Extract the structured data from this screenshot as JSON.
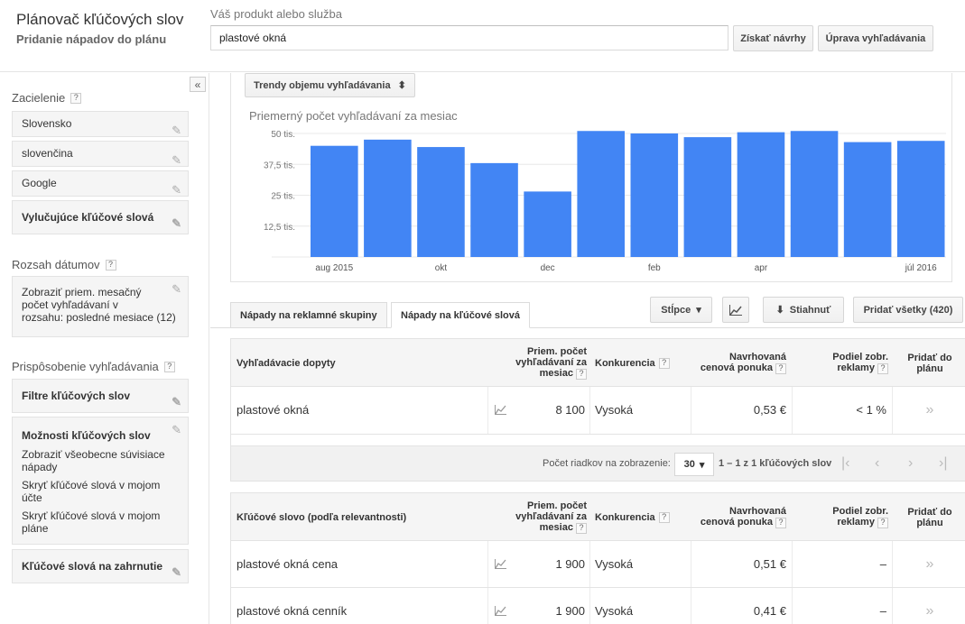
{
  "header": {
    "app_title": "Plánovač kľúčových slov",
    "app_subtitle": "Pridanie nápadov do plánu",
    "product_label": "Váš produkt alebo služba",
    "product_value": "plastové okná",
    "get_ideas_label": "Získať návrhy",
    "edit_search_label": "Úprava vyhľadávania"
  },
  "sidebar": {
    "collapse_glyph": "«",
    "targeting_title": "Zacielenie",
    "targeting_items": [
      "Slovensko",
      "slovenčina",
      "Google"
    ],
    "negative_keywords_label": "Vylučujúce kľúčové slová",
    "date_range_title": "Rozsah dátumov",
    "date_range_lines": [
      "Zobraziť priem. mesačný",
      "počet vyhľadávaní v",
      "rozsahu: posledné mesiace (12)"
    ],
    "customize_title": "Prispôsobenie vyhľadávania",
    "keyword_filters_label": "Filtre kľúčových slov",
    "keyword_options_label": "Možnosti kľúčových slov",
    "keyword_options_lines": [
      "Zobraziť všeobecne súvisiace",
      "nápady",
      "Skryť kľúčové slová v mojom",
      "účte",
      "Skryť kľúčové slová v mojom",
      "pláne"
    ],
    "keywords_to_include_label": "Kľúčové slová na zahrnutie",
    "help_glyph": "?",
    "edit_icon_glyph": "✎"
  },
  "chart_panel": {
    "trend_select_label": "Trendy objemu vyhľadávania",
    "select_arrows": "⬍",
    "chart_title": "Priemerný počet vyhľadávaní za mesiac"
  },
  "chart_data": {
    "type": "bar",
    "title": "Priemerný počet vyhľadávaní za mesiac",
    "categories": [
      "aug 2015",
      "sep 2015",
      "okt",
      "nov",
      "dec",
      "jan",
      "feb",
      "mar",
      "apr",
      "máj",
      "jún",
      "júl 2016"
    ],
    "x_tick_labels": [
      "aug 2015",
      "",
      "okt",
      "",
      "dec",
      "",
      "feb",
      "",
      "apr",
      "",
      "",
      "júl 2016"
    ],
    "values": [
      45000,
      47500,
      44500,
      38000,
      26500,
      51000,
      50000,
      48500,
      50500,
      51000,
      46500,
      47000
    ],
    "ylim": [
      0,
      50000
    ],
    "y_ticks": [
      12500,
      25000,
      37500,
      50000
    ],
    "y_tick_labels": [
      "12,5 tis.",
      "25 tis.",
      "37,5 tis.",
      "50 tis."
    ],
    "color": "#4285f4",
    "grid": true
  },
  "tabs": {
    "ad_groups": "Nápady na reklamné skupiny",
    "keywords": "Nápady na kľúčové slová"
  },
  "toolbar": {
    "columns_label": "Stĺpce",
    "columns_arrow": "▾",
    "chart_glyph": "⟋",
    "download_label": "Stiahnuť",
    "download_glyph": "⬇",
    "add_all_label": "Pridať všetky (420)"
  },
  "search_terms_table": {
    "headers": {
      "term": "Vyhľadávacie dopyty",
      "avg_searches": [
        "Priem. počet",
        "vyhľadávaní za",
        "mesiac"
      ],
      "competition": "Konkurencia",
      "bid": [
        "Navrhovaná",
        "cenová ponuka"
      ],
      "impr_share": [
        "Podiel zobr.",
        "reklamy"
      ],
      "add": [
        "Pridať do",
        "plánu"
      ]
    },
    "rows": [
      {
        "term": "plastové okná",
        "searches": "8 100",
        "competition": "Vysoká",
        "bid": "0,53 €",
        "share": "< 1 %"
      }
    ]
  },
  "pager": {
    "rows_label": "Počet riadkov na zobrazenie:",
    "rows_value": "30",
    "rows_arrow": "▾",
    "range": "1 – 1 z 1 kľúčových slov",
    "first": "|‹",
    "prev": "‹",
    "next": "›",
    "last": "›|"
  },
  "keywords_table": {
    "headers": {
      "term": "Kľúčové slovo (podľa relevantnosti)",
      "avg_searches": [
        "Priem. počet",
        "vyhľadávaní za",
        "mesiac"
      ],
      "competition": "Konkurencia",
      "bid": [
        "Navrhovaná",
        "cenová ponuka"
      ],
      "impr_share": [
        "Podiel zobr.",
        "reklamy"
      ],
      "add": [
        "Pridať do",
        "plánu"
      ]
    },
    "rows": [
      {
        "term": "plastové okná cena",
        "searches": "1 900",
        "competition": "Vysoká",
        "bid": "0,51 €",
        "share": "–"
      },
      {
        "term": "plastové okná cenník",
        "searches": "1 900",
        "competition": "Vysoká",
        "bid": "0,41 €",
        "share": "–"
      }
    ]
  },
  "row_glyphs": {
    "trend": "📈",
    "add": "»"
  }
}
